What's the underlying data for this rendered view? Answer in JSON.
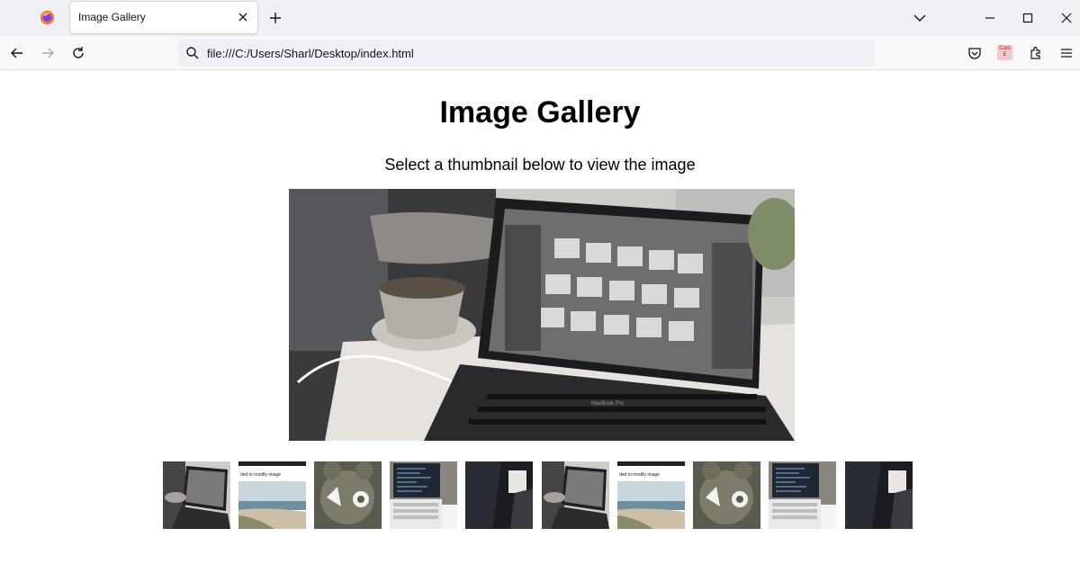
{
  "browser": {
    "tab_title": "Image Gallery",
    "address": "file:///C:/Users/Sharl/Desktop/index.html",
    "extension_badge": "Cors E"
  },
  "page": {
    "heading": "Image Gallery",
    "subheading": "Select a thumbnail below to view the image"
  },
  "gallery": {
    "main_image_caption": "MacBook Pro",
    "main_image_subject": "laptop",
    "thumbnails": [
      {
        "kind": "laptop"
      },
      {
        "kind": "beach",
        "caption": "ded to modify image"
      },
      {
        "kind": "plush"
      },
      {
        "kind": "code"
      },
      {
        "kind": "dark"
      },
      {
        "kind": "laptop"
      },
      {
        "kind": "beach",
        "caption": "ded to modify image"
      },
      {
        "kind": "plush"
      },
      {
        "kind": "code"
      },
      {
        "kind": "dark"
      }
    ]
  },
  "colors": {
    "tabbar_bg": "#f0f0f4",
    "navbar_bg": "#f9f9fb",
    "accent_firefox": "#e66000"
  }
}
